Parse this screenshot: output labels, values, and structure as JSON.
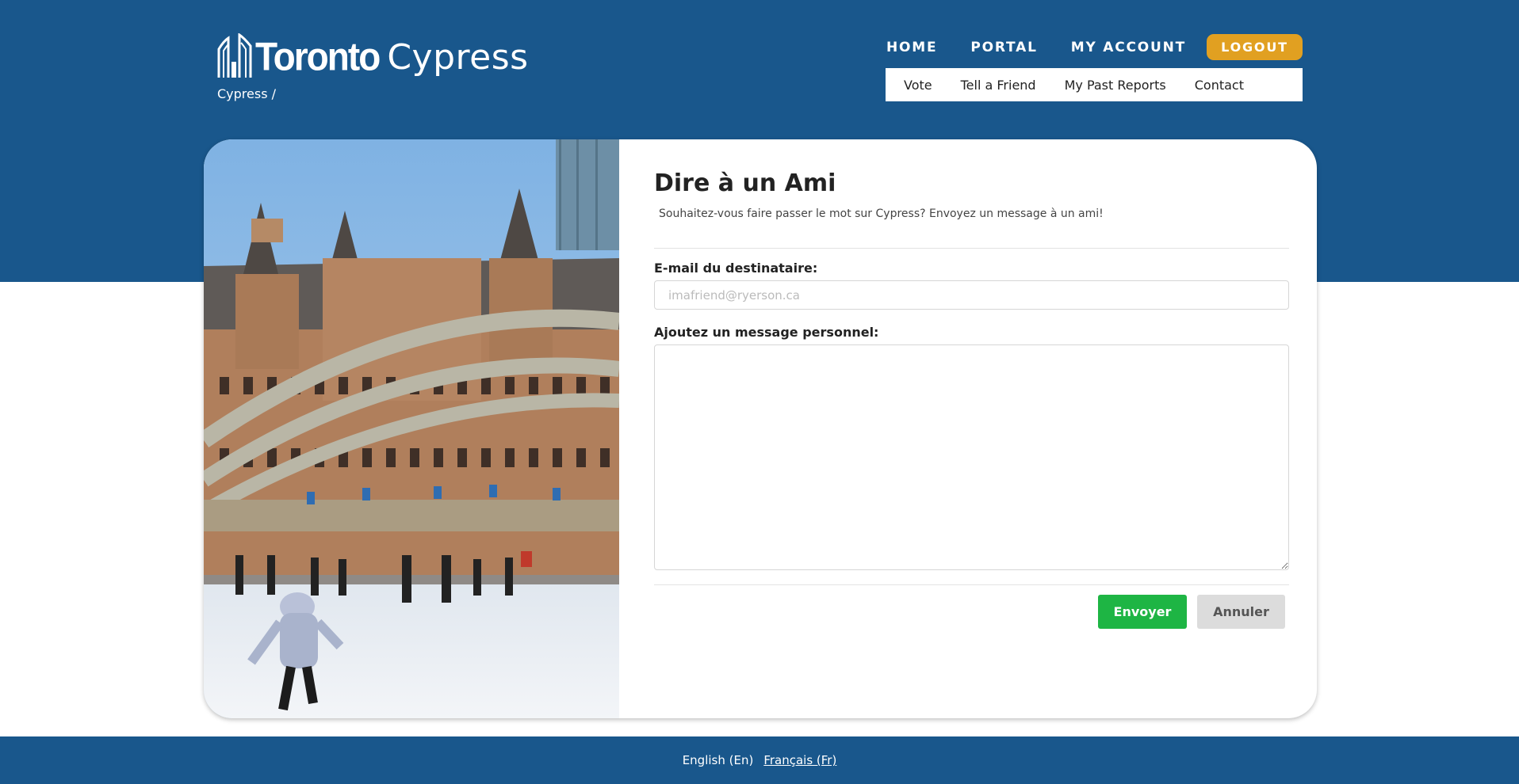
{
  "header": {
    "logo_toronto": "Toronto",
    "logo_app": "Cypress",
    "breadcrumb": "Cypress /",
    "nav": [
      "HOME",
      "PORTAL",
      "MY ACCOUNT"
    ],
    "logout_label": "LOGOUT",
    "sub_nav": [
      "Vote",
      "Tell a Friend",
      "My Past Reports",
      "Contact"
    ]
  },
  "form": {
    "title": "Dire à un Ami",
    "subtitle": "Souhaitez-vous faire passer le mot sur Cypress? Envoyez un message à un ami!",
    "email_label": "E-mail du destinataire:",
    "email_placeholder": "imafriend@ryerson.ca",
    "email_value": "",
    "message_label": "Ajoutez un message personnel:",
    "message_value": "",
    "send_label": "Envoyer",
    "cancel_label": "Annuler"
  },
  "footer": {
    "lang_en": "English (En)",
    "lang_fr": "Français (Fr)"
  },
  "colors": {
    "brand_blue": "#19578c",
    "logout_orange": "#e1a021",
    "send_green": "#1eb544",
    "cancel_gray": "#dcdcdc"
  },
  "icons": {
    "logo_mark": "city-hall-towers-icon",
    "resize_handle": "resize-grip-icon"
  }
}
